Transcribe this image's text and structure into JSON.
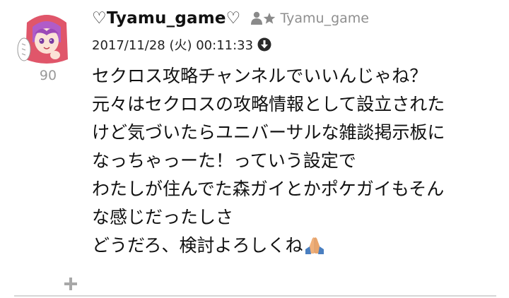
{
  "post": {
    "number": "90",
    "username": "♡Tyamu_game♡",
    "user_id": "Tyamu_game",
    "timestamp": "2017/11/28 (火) 00:11:33",
    "lines": [
      "セクロス攻略チャンネルでいいんじゃね？",
      "元々はセクロスの攻略情報として設立された",
      "けど気づいたらユニバーサルな雑談掲示板に",
      "なっちゃっーた！っていう設定で",
      "わたしが住んでた森ガイとかポケガイもそん",
      "な感じだったしさ",
      "どうだろ、検討よろしくね"
    ]
  },
  "icons": {
    "badge": "person-star-icon",
    "download": "download-icon",
    "emoji": "folded-hands-emoji",
    "add": "plus-icon"
  },
  "colors": {
    "text": "#111111",
    "muted": "#9a9a9a",
    "divider": "#d6d6d6",
    "emoji_skin": "#f0b07a",
    "emoji_sleeve": "#4a7fc0"
  }
}
